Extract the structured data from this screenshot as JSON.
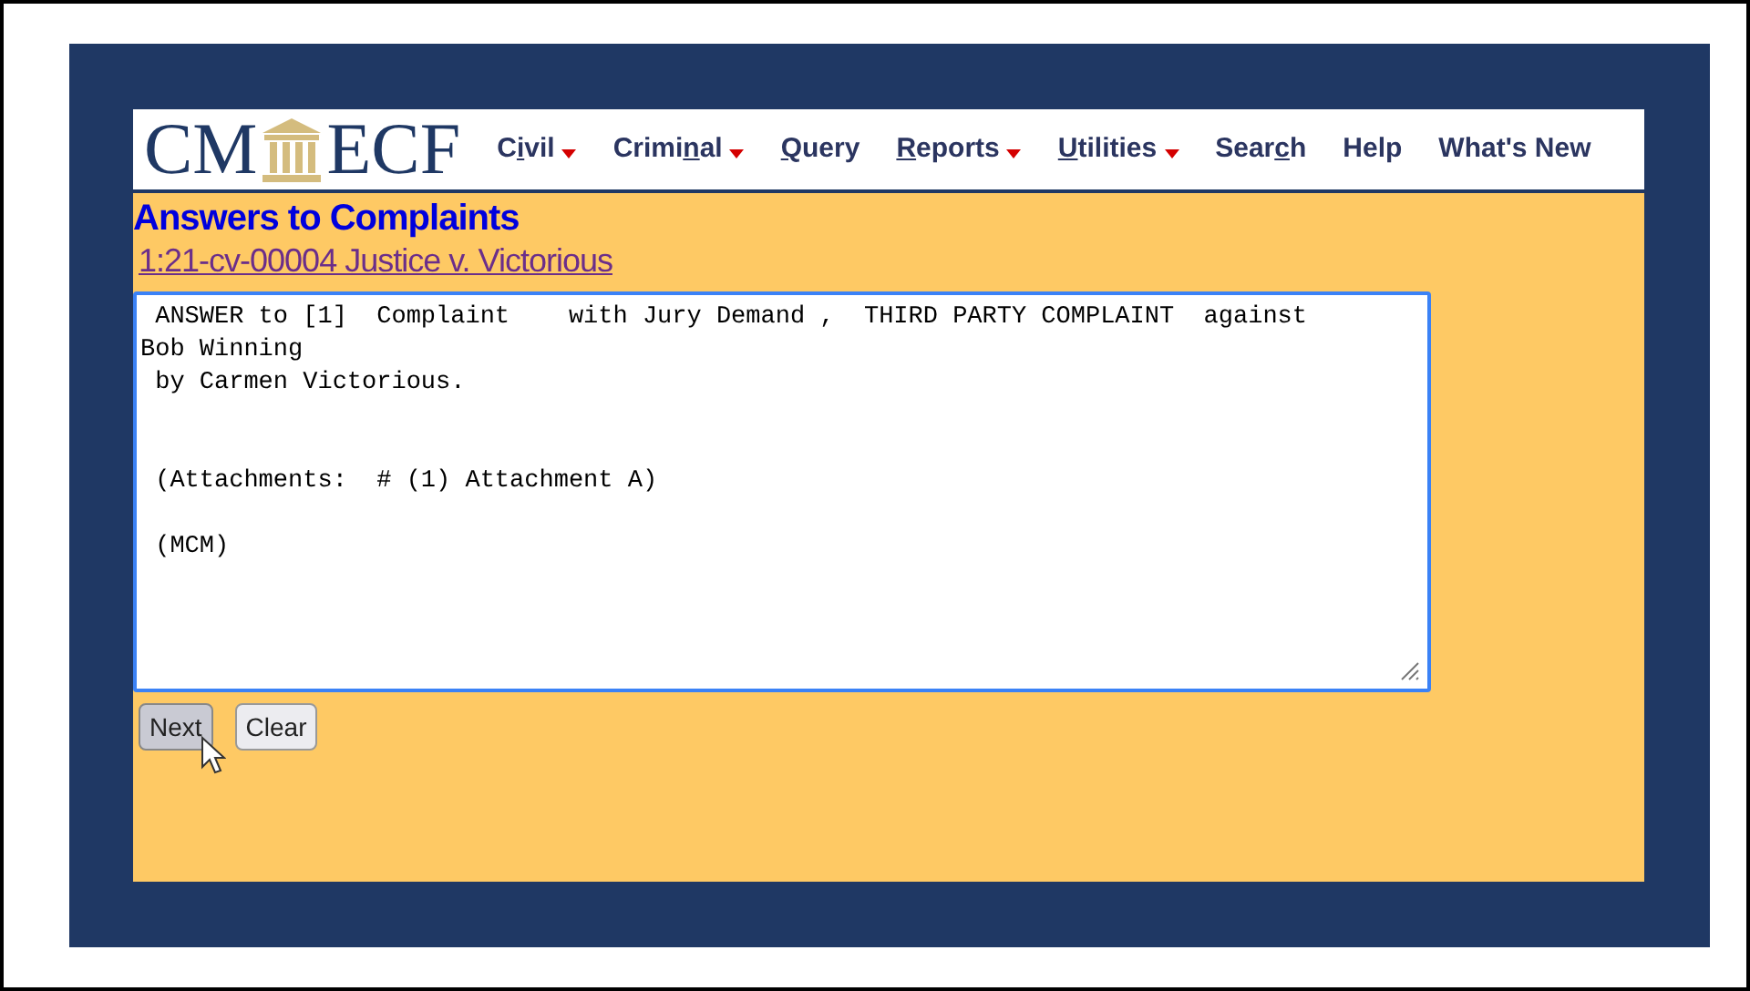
{
  "logo": {
    "left": "CM",
    "right": "ECF"
  },
  "menu": [
    {
      "before": "C",
      "key": "i",
      "after": "vil",
      "dropdown": true
    },
    {
      "before": "Crimi",
      "key": "n",
      "after": "al",
      "dropdown": true
    },
    {
      "key": "Q",
      "after": "uery",
      "dropdown": false
    },
    {
      "key": "R",
      "after": "eports",
      "dropdown": true
    },
    {
      "key": "U",
      "after": "tilities",
      "dropdown": true
    },
    {
      "before": "Sear",
      "key": "c",
      "after": "h",
      "dropdown": false
    },
    {
      "before": "Help",
      "dropdown": false
    },
    {
      "before": "What's New",
      "dropdown": false
    }
  ],
  "page_title": "Answers to Complaints",
  "case_link": "1:21-cv-00004 Justice v. Victorious",
  "docket_text": {
    "value": " ANSWER to [1]  Complaint    with Jury Demand ,  THIRD PARTY COMPLAINT  against\nBob Winning\n by Carmen Victorious.\n\n\n (Attachments:  # (1) Attachment A)\n\n (MCM)\n"
  },
  "buttons": [
    {
      "label": "Next",
      "hovered": true
    },
    {
      "label": "Clear",
      "hovered": false
    }
  ]
}
